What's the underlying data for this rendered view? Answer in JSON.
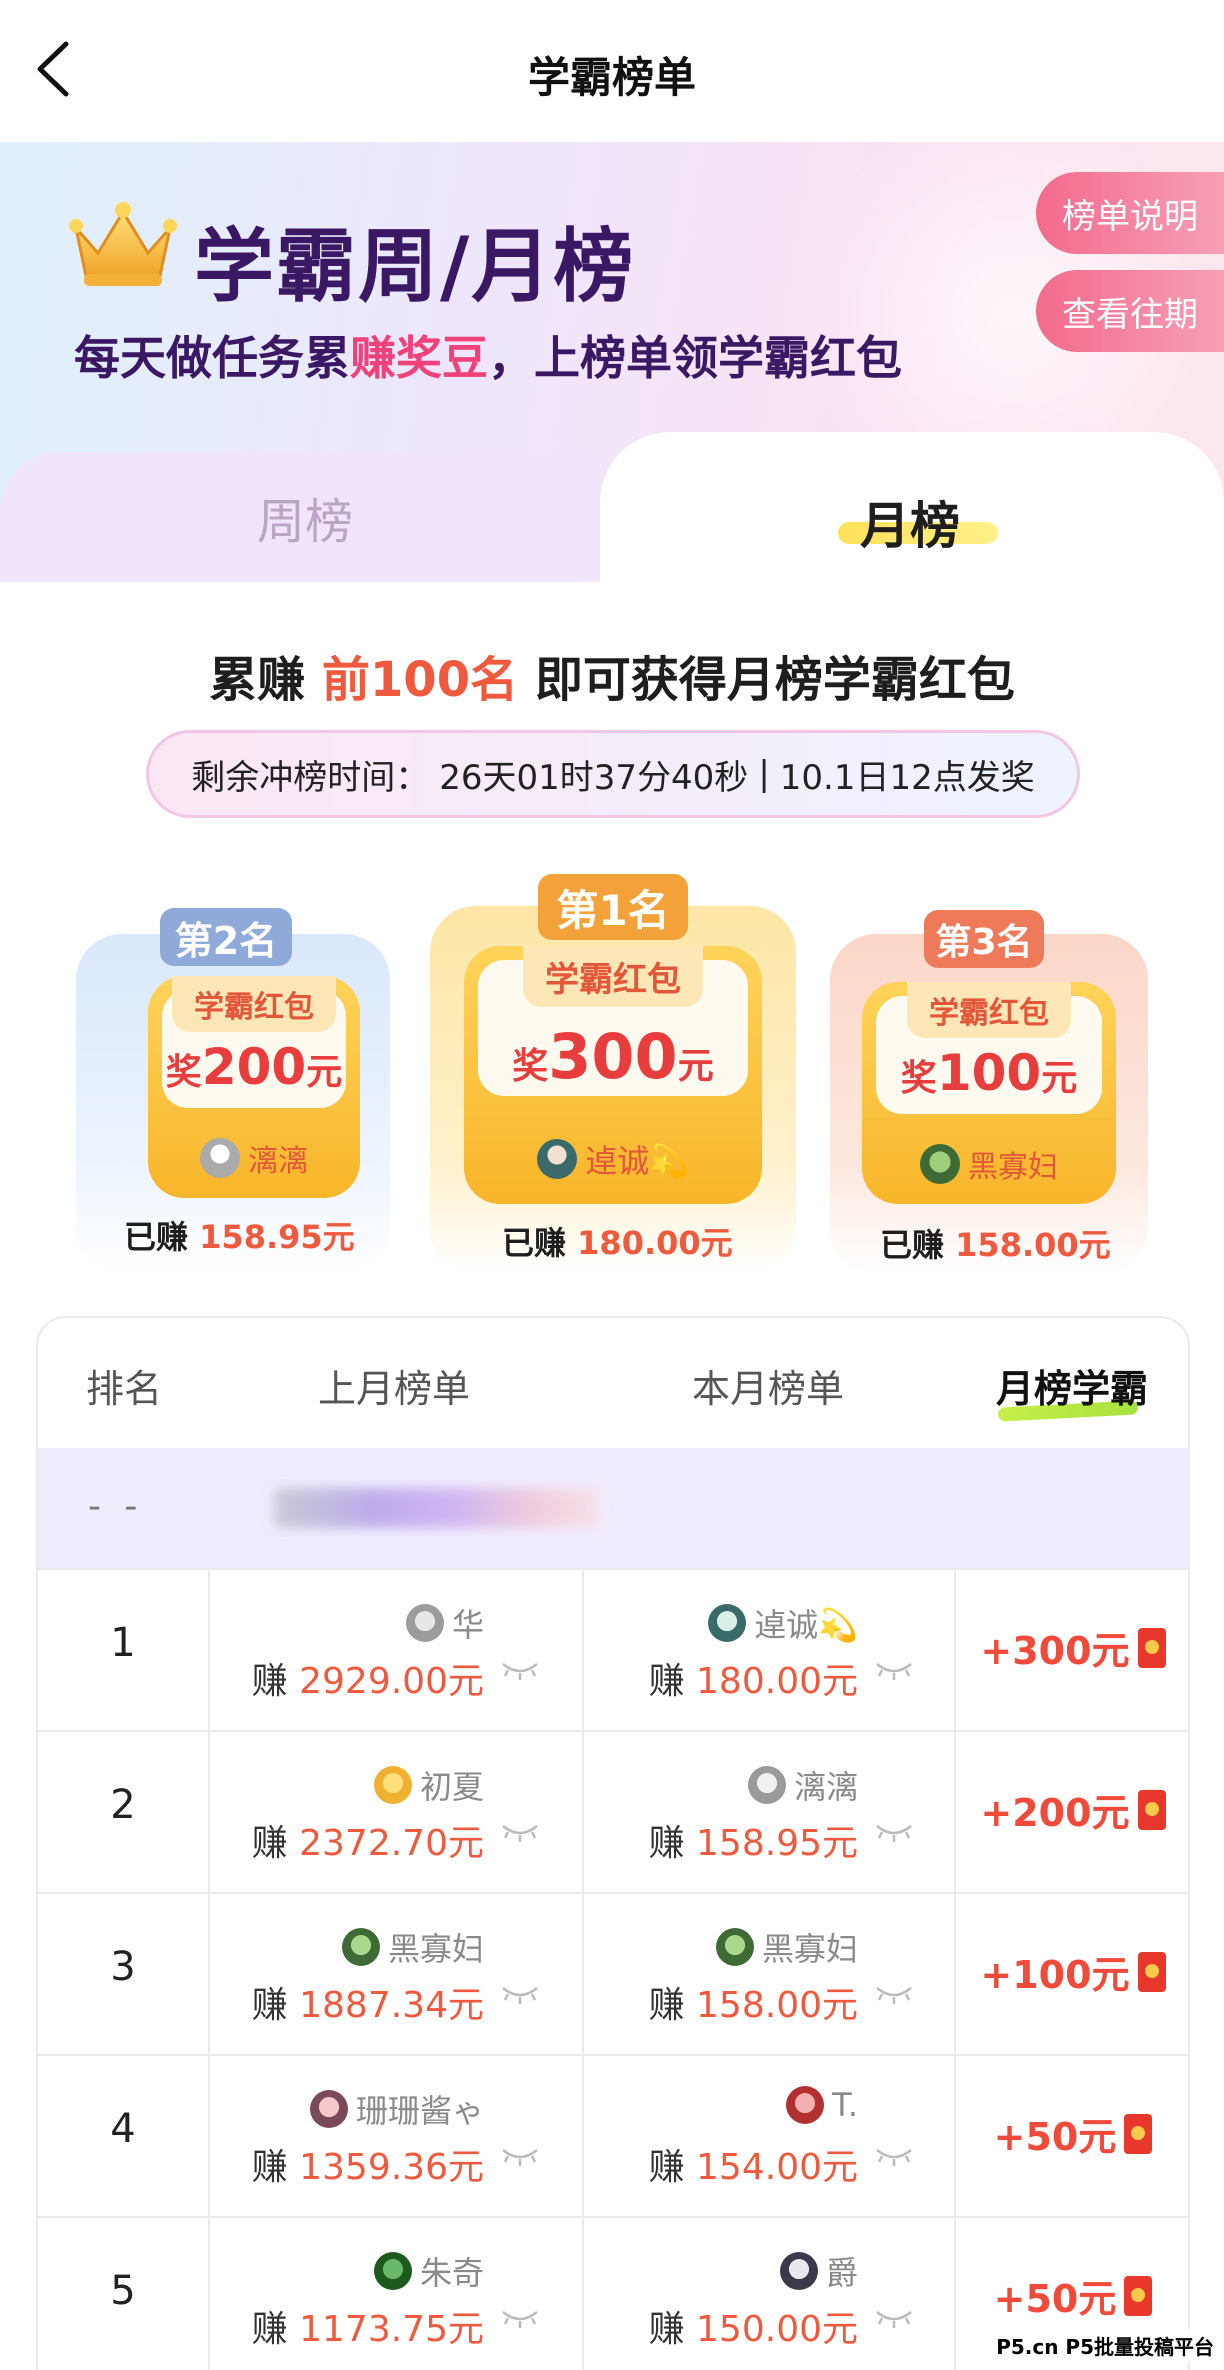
{
  "header": {
    "title": "学霸榜单"
  },
  "banner": {
    "title": "学霸周/月榜",
    "subtitle_pre": "每天做任务累",
    "subtitle_hl": "赚奖豆",
    "subtitle_post": "，上榜单领学霸红包",
    "rules_button": "榜单说明",
    "history_button": "查看往期"
  },
  "tabs": {
    "weekly": "周榜",
    "monthly": "月榜",
    "active": "monthly"
  },
  "headline": {
    "pre": "累赚",
    "highlight": "前100名",
    "post": "即可获得月榜学霸红包"
  },
  "countdown": {
    "label": "剩余冲榜时间：",
    "time": "26天01时37分40秒",
    "sep": "|",
    "note": "10.1日12点发奖"
  },
  "podium": {
    "first": {
      "badge": "第1名",
      "envelope_label": "学霸红包",
      "prize_prefix": "奖",
      "prize_amount": "300",
      "prize_unit": "元",
      "user": "逴诚💫",
      "earned_label": "已赚",
      "earned_amount": "180.00元"
    },
    "second": {
      "badge": "第2名",
      "envelope_label": "学霸红包",
      "prize_prefix": "奖",
      "prize_amount": "200",
      "prize_unit": "元",
      "user": "漓漓",
      "earned_label": "已赚",
      "earned_amount": "158.95元"
    },
    "third": {
      "badge": "第3名",
      "envelope_label": "学霸红包",
      "prize_prefix": "奖",
      "prize_amount": "100",
      "prize_unit": "元",
      "user": "黑寡妇",
      "earned_label": "已赚",
      "earned_amount": "158.00元"
    }
  },
  "table": {
    "headers": {
      "rank": "排名",
      "last_month": "上月榜单",
      "this_month": "本月榜单",
      "award": "月榜学霸"
    },
    "my_row": {
      "rank": "- -"
    },
    "earn_prefix": "赚",
    "rows": [
      {
        "rank": "1",
        "last_user": "华",
        "last_amount": "2929.00元",
        "this_user": "逴诚💫",
        "this_amount": "180.00元",
        "award": "+300元"
      },
      {
        "rank": "2",
        "last_user": "初夏",
        "last_amount": "2372.70元",
        "this_user": "漓漓",
        "this_amount": "158.95元",
        "award": "+200元"
      },
      {
        "rank": "3",
        "last_user": "黑寡妇",
        "last_amount": "1887.34元",
        "this_user": "黑寡妇",
        "this_amount": "158.00元",
        "award": "+100元"
      },
      {
        "rank": "4",
        "last_user": "珊珊酱ゃ",
        "last_amount": "1359.36元",
        "this_user": "T.",
        "this_amount": "154.00元",
        "award": "+50元"
      },
      {
        "rank": "5",
        "last_user": "朱奇",
        "last_amount": "1173.75元",
        "this_user": "爵",
        "this_amount": "150.00元",
        "award": "+50元"
      }
    ]
  },
  "watermark": "P5.cn P5批量投稿平台",
  "colors": {
    "accent_red": "#ef5a3f",
    "banner_purple": "#3a1863",
    "pink_button": "#f36a8c"
  }
}
